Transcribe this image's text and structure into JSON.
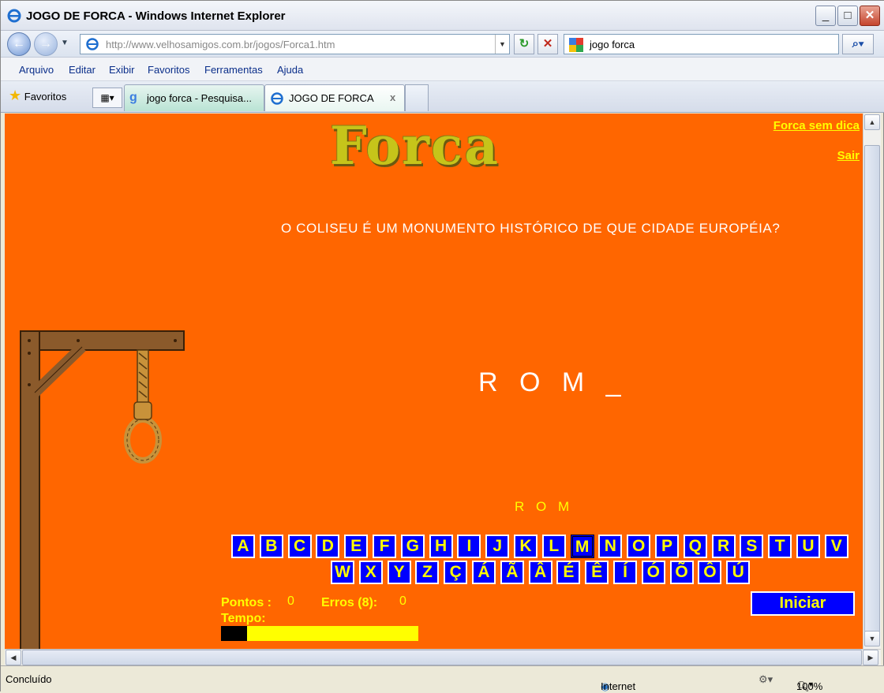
{
  "window": {
    "title": "JOGO DE FORCA - Windows Internet Explorer"
  },
  "address": {
    "url": "http://www.velhosamigos.com.br/jogos/Forca1.htm",
    "search_value": "jogo forca"
  },
  "menu": [
    "Arquivo",
    "Editar",
    "Exibir",
    "Favoritos",
    "Ferramentas",
    "Ajuda"
  ],
  "tabs": {
    "favorites_label": "Favoritos",
    "items": [
      {
        "label": "jogo forca - Pesquisa..."
      },
      {
        "label": "JOGO DE FORCA",
        "close": "x"
      }
    ]
  },
  "page": {
    "logo": "Forca",
    "link_no_hint": "Forca sem dica",
    "link_exit": "Sair",
    "question": "O COLISEU É UM MONUMENTO HISTÓRICO DE QUE CIDADE EUROPÉIA?",
    "word": "R O M _",
    "guessed": "R O M",
    "keys_row1": [
      "A",
      "B",
      "C",
      "D",
      "E",
      "F",
      "G",
      "H",
      "I",
      "J",
      "K",
      "L",
      "M",
      "N",
      "O",
      "P",
      "Q",
      "R",
      "S",
      "T",
      "U",
      "V"
    ],
    "keys_row2": [
      "W",
      "X",
      "Y",
      "Z",
      "Ç",
      "Á",
      "Ã",
      "Â",
      "É",
      "Ê",
      "Í",
      "Ó",
      "Õ",
      "Ô",
      "Ú"
    ],
    "used_key": "M",
    "points_label": "Pontos :",
    "points_value": "0",
    "errors_label": "Erros (8):",
    "errors_value": "0",
    "time_label": "Tempo:",
    "time_fraction": 0.13,
    "start_button": "Iniciar"
  },
  "status": {
    "text": "Concluído",
    "zone": "Internet",
    "zoom": "100%"
  },
  "colors": {
    "background": "#ff6600",
    "key_bg": "#0000ff",
    "key_text": "#ffff00"
  }
}
